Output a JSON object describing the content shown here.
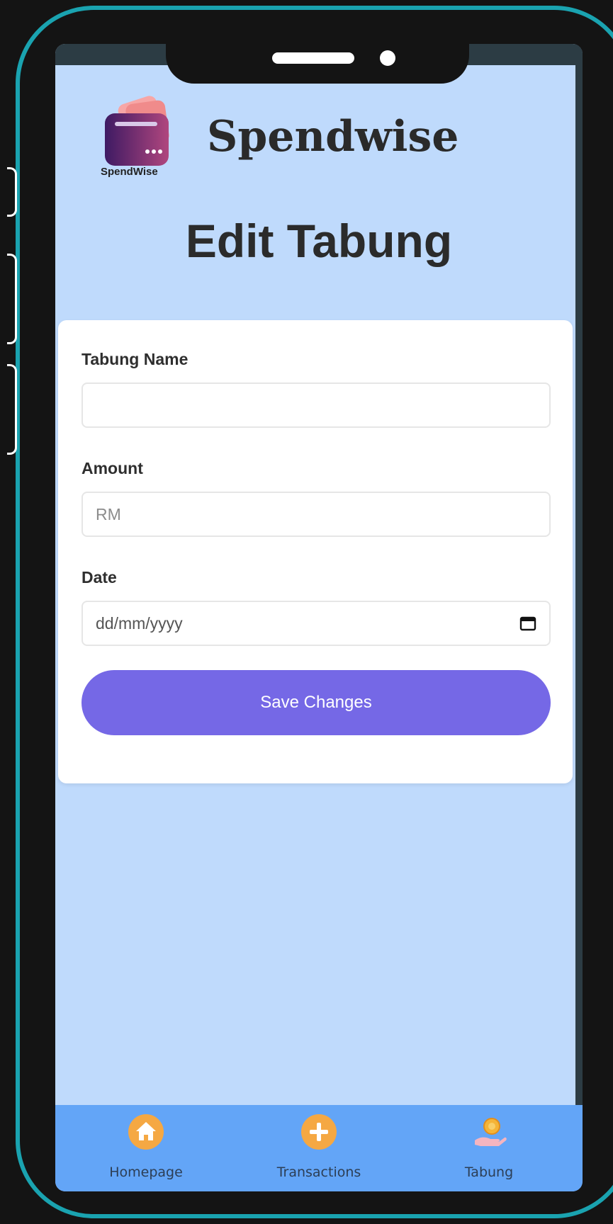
{
  "app": {
    "brand": "Spendwise",
    "logo_caption": "SpendWise"
  },
  "page": {
    "title": "Edit Tabung"
  },
  "form": {
    "name_label": "Tabung Name",
    "name_value": "",
    "amount_label": "Amount",
    "amount_placeholder": "RM",
    "date_label": "Date",
    "date_placeholder": "dd/mm/yyyy",
    "save_label": "Save Changes"
  },
  "nav": {
    "items": [
      {
        "label": "Homepage",
        "icon": "home-icon"
      },
      {
        "label": "Transactions",
        "icon": "plus-icon"
      },
      {
        "label": "Tabung",
        "icon": "savings-hand-icon"
      }
    ]
  },
  "colors": {
    "accent": "#7568e6",
    "nav_bg": "#63a5f7",
    "screen_bg": "#bfdafc",
    "frame": "#1aa3b0"
  }
}
